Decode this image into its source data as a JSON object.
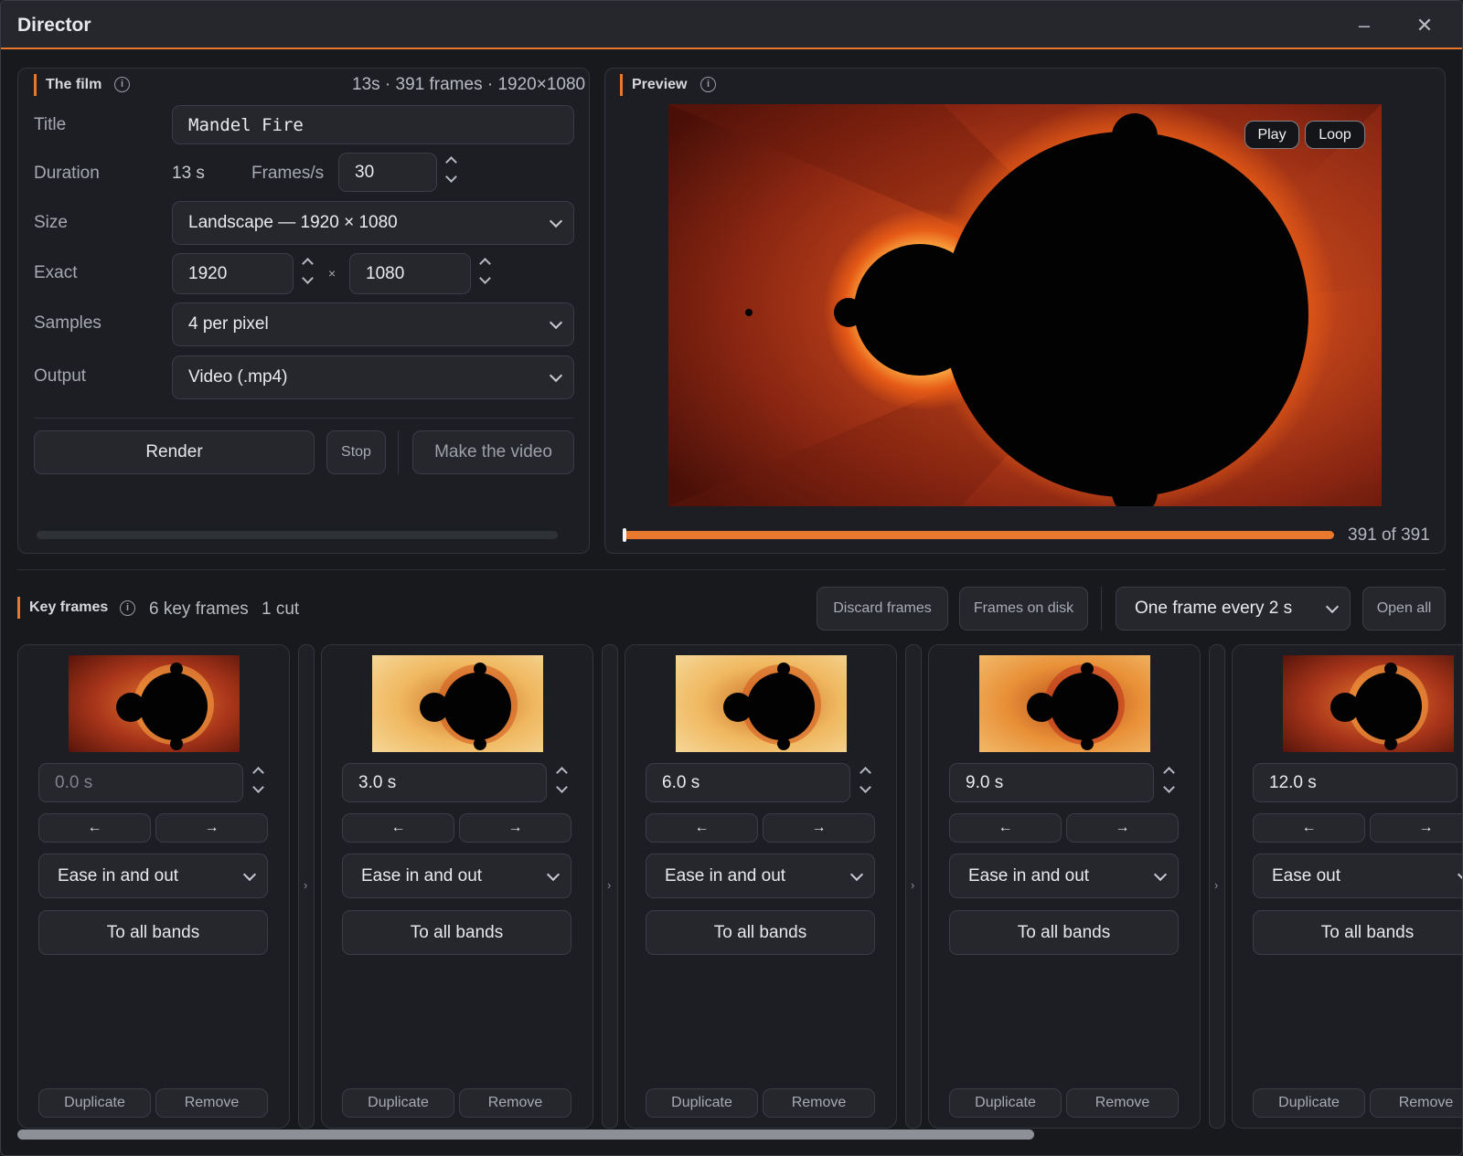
{
  "window": {
    "title": "Director",
    "minimize": "–",
    "close": "✕"
  },
  "film": {
    "section_label": "The film",
    "summary": "13s · 391 frames · 1920×1080",
    "title_label": "Title",
    "title_value": "Mandel Fire",
    "duration_label": "Duration",
    "duration_value": "13 s",
    "fps_label": "Frames/s",
    "fps_value": "30",
    "size_label": "Size",
    "size_value": "Landscape — 1920 × 1080",
    "exact_label": "Exact",
    "exact_width": "1920",
    "times": "×",
    "exact_height": "1080",
    "samples_label": "Samples",
    "samples_value": "4 per pixel",
    "output_label": "Output",
    "output_value": "Video (.mp4)",
    "render_button": "Render",
    "stop_button": "Stop",
    "make_video_button": "Make the video"
  },
  "preview": {
    "section_label": "Preview",
    "play_button": "Play",
    "loop_button": "Loop",
    "frame_counter": "391 of 391",
    "progress": 1.0
  },
  "keyframes": {
    "section_label": "Key frames",
    "count_text": "6 key frames",
    "cut_text": "1 cut",
    "discard_button": "Discard frames",
    "frames_on_disk_button": "Frames on disk",
    "interval_value": "One frame every 2 s",
    "open_all_button": "Open all",
    "cards": [
      {
        "time": "0.0 s",
        "prev": "←",
        "next": "→",
        "easing": "Ease in and out",
        "apply": "To all bands",
        "duplicate": "Duplicate",
        "remove": "Remove",
        "palette": "red"
      },
      {
        "time": "3.0 s",
        "prev": "←",
        "next": "→",
        "easing": "Ease in and out",
        "apply": "To all bands",
        "duplicate": "Duplicate",
        "remove": "Remove",
        "palette": "gold"
      },
      {
        "time": "6.0 s",
        "prev": "←",
        "next": "→",
        "easing": "Ease in and out",
        "apply": "To all bands",
        "duplicate": "Duplicate",
        "remove": "Remove",
        "palette": "gold"
      },
      {
        "time": "9.0 s",
        "prev": "←",
        "next": "→",
        "easing": "Ease in and out",
        "apply": "To all bands",
        "duplicate": "Duplicate",
        "remove": "Remove",
        "palette": "amber"
      },
      {
        "time": "12.0 s",
        "prev": "←",
        "next": "→",
        "easing": "Ease out",
        "apply": "To all bands",
        "duplicate": "Duplicate",
        "remove": "Remove",
        "palette": "red"
      }
    ],
    "gap_arrow": "›"
  },
  "colors": {
    "accent": "#e8782e",
    "background": "#17191d",
    "panel": "#1c1e23"
  }
}
